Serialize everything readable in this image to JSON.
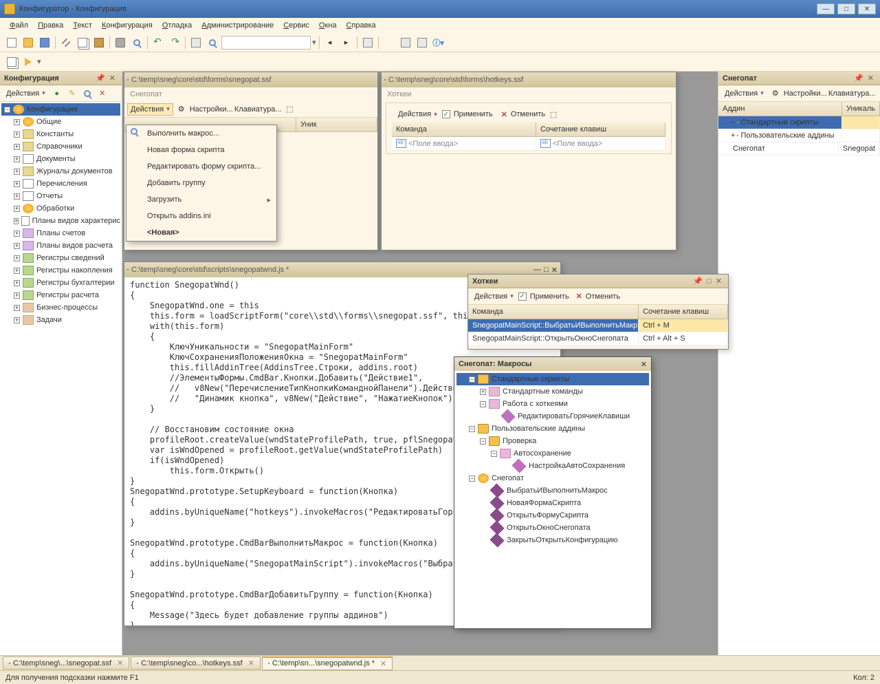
{
  "title": "Конфигуратор - Конфигурация",
  "menus": [
    "Файл",
    "Правка",
    "Текст",
    "Конфигурация",
    "Отладка",
    "Администрирование",
    "Сервис",
    "Окна",
    "Справка"
  ],
  "leftPanel": {
    "title": "Конфигурация",
    "actions": "Действия"
  },
  "configTree": {
    "root": "Конфигурация",
    "items": [
      {
        "l": "Общие",
        "ic": "ic-gear"
      },
      {
        "l": "Константы",
        "ic": "ic-ref"
      },
      {
        "l": "Справочники",
        "ic": "ic-ref"
      },
      {
        "l": "Документы",
        "ic": "ic-doc"
      },
      {
        "l": "Журналы документов",
        "ic": "ic-ref"
      },
      {
        "l": "Перечисления",
        "ic": "ic-doc"
      },
      {
        "l": "Отчеты",
        "ic": "ic-doc"
      },
      {
        "l": "Обработки",
        "ic": "ic-gear"
      },
      {
        "l": "Планы видов характерис",
        "ic": "ic-doc"
      },
      {
        "l": "Планы счетов",
        "ic": "ic-calc"
      },
      {
        "l": "Планы видов расчета",
        "ic": "ic-calc"
      },
      {
        "l": "Регистры сведений",
        "ic": "ic-reg"
      },
      {
        "l": "Регистры накопления",
        "ic": "ic-reg"
      },
      {
        "l": "Регистры бухгалтерии",
        "ic": "ic-reg"
      },
      {
        "l": "Регистры расчета",
        "ic": "ic-reg"
      },
      {
        "l": "Бизнес-процессы",
        "ic": "ic-task"
      },
      {
        "l": "Задачи",
        "ic": "ic-task"
      }
    ]
  },
  "winSnegopat": {
    "path": "C:\\temp\\sneg\\core\\std\\forms\\snegopat.ssf",
    "sub": "Снегопат",
    "actions": "Действия",
    "settings": "Настройки...",
    "keyboard": "Клавиатура...",
    "colUnique": "Уник"
  },
  "ddmenu": [
    {
      "l": "Выполнить макрос...",
      "ic": 1
    },
    {
      "l": "Новая форма скрипта"
    },
    {
      "l": "Редактировать форму скрипта..."
    },
    {
      "l": "Добавить группу"
    },
    {
      "l": "Загрузить",
      "sub": 1
    },
    {
      "l": "Открыть addins.ini"
    },
    {
      "l": "<Новая>",
      "bold": 1
    }
  ],
  "winHotkeys": {
    "path": "C:\\temp\\sneg\\core\\std\\forms\\hotkeys.ssf",
    "sub": "Хоткеи",
    "actions": "Действия",
    "apply": "Применить",
    "cancel": "Отменить",
    "colCmd": "Команда",
    "colKey": "Сочетание клавиш",
    "ph": "<Поле ввода>"
  },
  "winCode": {
    "path": "C:\\temp\\sneg\\core\\std\\scripts\\snegopatwnd.js *",
    "code": "function SnegopatWnd()\n{\n    SnegopatWnd.one = this\n    this.form = loadScriptForm(\"core\\\\std\\\\forms\\\\snegopat.ssf\", this)\n    with(this.form)\n    {\n        КлючУникальности = \"SnegopatMainForm\"\n        КлючСохраненияПоложенияОкна = \"SnegopatMainForm\"\n        this.fillAddinTree(AddinsTree.Строки, addins.root)\n        //ЭлементыФормы.CmdBar.Кнопки.Добавить(\"Действие1\",\n        //   v8New(\"ПеречислениеТипКнопкиКоманднойПанели\").Действие,\n        //   \"Динамик кнопка\", v8New(\"Действие\", \"НажатиеКнопок\"))\n    }\n\n    // Восстановим состояние окна\n    profileRoot.createValue(wndStateProfilePath, true, pflSnegopat)\n    var isWndOpened = profileRoot.getValue(wndStateProfilePath)\n    if(isWndOpened)\n        this.form.Открыть()\n}\nSnegopatWnd.prototype.SetupKeyboard = function(Кнопка)\n{\n    addins.byUniqueName(\"hotkeys\").invokeMacros(\"РедактироватьГорячиеКлавиши\")\n}\n\nSnegopatWnd.prototype.CmdBarВыполнитьМакрос = function(Кнопка)\n{\n    addins.byUniqueName(\"SnegopatMainScript\").invokeMacros(\"ВыбратьИВыполнитьМакрос\")\n}\n\nSnegopatWnd.prototype.CmdBarДобавитьГруппу = function(Кнопка)\n{\n    Message(\"Здесь будет добавление группы аддинов\")\n}"
  },
  "rightPanel": {
    "title": "Снегопат",
    "actions": "Действия",
    "settings": "Настройки...",
    "keyboard": "Клавиатура...",
    "colAddin": "Аддин",
    "colUnique": "Уникаль",
    "tree": [
      {
        "l": "Стандартные скрипты",
        "sel": 1,
        "lvl": 1,
        "ic": "ic-fld",
        "exp": "−"
      },
      {
        "l": "Пользовательские аддины",
        "lvl": 1,
        "ic": "ic-fld",
        "exp": "+"
      },
      {
        "l": "Снегопат",
        "lvl": 1,
        "ic": "ic-gear",
        "u": "Snegopat"
      }
    ]
  },
  "floatHotkeys": {
    "title": "Хоткеи",
    "actions": "Действия",
    "apply": "Применить",
    "cancel": "Отменить",
    "colCmd": "Команда",
    "colKey": "Сочетание клавиш",
    "rows": [
      {
        "c": "SnegopatMainScript::ВыбратьИВыполнитьМакр...",
        "k": "Ctrl + M",
        "sel": 1
      },
      {
        "c": "SnegopatMainScript::ОткрытьОкноСнегопата",
        "k": "Ctrl + Alt + S"
      }
    ]
  },
  "floatMacros": {
    "title": "Снегопат: Макросы",
    "tree": [
      {
        "l": "Стандартные скрипты",
        "lvl": 0,
        "ic": "ic-fld",
        "exp": "−",
        "sel": 1
      },
      {
        "l": "Стандартные команды",
        "lvl": 1,
        "ic": "ic-form",
        "exp": "+"
      },
      {
        "l": "Работа с хоткеями",
        "lvl": 1,
        "ic": "ic-form",
        "exp": "−"
      },
      {
        "l": "РедактироватьГорячиеКлавиши",
        "lvl": 2,
        "ic": "ic-diam"
      },
      {
        "l": "Пользовательские аддины",
        "lvl": 0,
        "ic": "ic-fld",
        "exp": "−"
      },
      {
        "l": "Проверка",
        "lvl": 1,
        "ic": "ic-fld",
        "exp": "−"
      },
      {
        "l": "Автосохранение",
        "lvl": 2,
        "ic": "ic-form",
        "exp": "−"
      },
      {
        "l": "НастройкаАвтоСохранения",
        "lvl": 3,
        "ic": "ic-diam"
      },
      {
        "l": "Снегопат",
        "lvl": 0,
        "ic": "ic-gear",
        "exp": "−"
      },
      {
        "l": "ВыбратьИВыполнитьМакрос",
        "lvl": 1,
        "ic": "ic-dk"
      },
      {
        "l": "НоваяФормаСкрипта",
        "lvl": 1,
        "ic": "ic-dk"
      },
      {
        "l": "ОткрытьФормуСкрипта",
        "lvl": 1,
        "ic": "ic-dk"
      },
      {
        "l": "ОткрытьОкноСнегопата",
        "lvl": 1,
        "ic": "ic-dk"
      },
      {
        "l": "ЗакрытьОткрытьКонфигурацию",
        "lvl": 1,
        "ic": "ic-dk"
      }
    ]
  },
  "tabs": [
    {
      "l": "C:\\temp\\sneg\\...\\snegopat.ssf"
    },
    {
      "l": "C:\\temp\\sneg\\co...\\hotkeys.ssf"
    },
    {
      "l": "C:\\temp\\sn...\\snegopatwnd.js *",
      "active": 1
    }
  ],
  "status": {
    "hint": "Для получения подсказки нажмите F1",
    "count": "Кол: 2"
  }
}
